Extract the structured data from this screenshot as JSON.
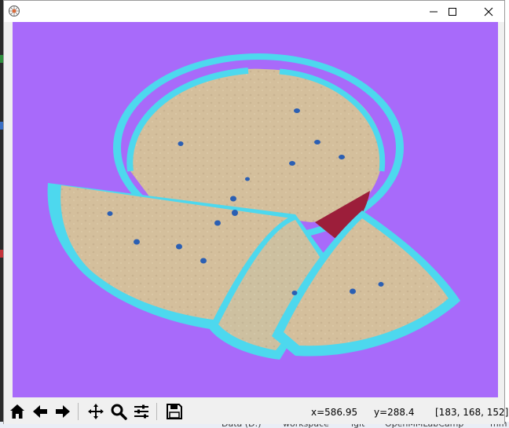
{
  "window": {
    "controls": [
      "minimize-icon",
      "maximize-icon",
      "close-icon"
    ]
  },
  "image": {
    "description_colors": {
      "background": "#a86afa",
      "rind": "#4dd8ee",
      "flesh": "#d4bf9c",
      "seed": "#2b5fb3",
      "accent": "#9c1e3a"
    }
  },
  "toolbar": {
    "tools": [
      "home-icon",
      "back-arrow-icon",
      "forward-arrow-icon",
      "pan-move-icon",
      "zoom-magnifier-icon",
      "configure-subplots-icon",
      "save-floppy-icon"
    ]
  },
  "status": {
    "x": "x=586.95",
    "y": "y=288.4",
    "rgb": "[183, 168, 152]"
  },
  "taskbar": {
    "items": [
      "Data (D:)",
      "workspace",
      "lgit",
      "OpenMMLabCamp",
      "mm"
    ]
  }
}
